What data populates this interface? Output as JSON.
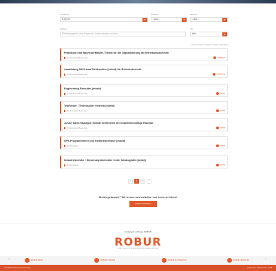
{
  "filters": {
    "position_label": "Positionen",
    "position_value": "8.00.00",
    "location_label": "Standort",
    "location_value": "- Alle -",
    "area_label": "Bereich",
    "area_value": "- Alle -",
    "search_label": "Suchen",
    "search_placeholder": "Stellenangebot oder Keyword, Unternehmen suchen",
    "type_label": "Art",
    "type_value": "Alle",
    "note": "Nur bei Cookies akzeptiert ist Stellen auffindbar!"
  },
  "jobs": [
    {
      "title": "Praktikum und Bachelor/Master-Thema für die Digitalisierung im Betriebsmaschinen",
      "meta": "Professional Bewerber",
      "badge": "Praktikum"
    },
    {
      "title": "Ausbildung 2022 zum Elektroniker (m/w/d) für Betriebstechnik",
      "meta": "Professional Bewerber",
      "badge": "Ausbildung"
    },
    {
      "title": "Engineering Recruiter (m/w/d)",
      "meta": "Professional Bewerber",
      "badge": "Vollzeit"
    },
    {
      "title": "Teamleiter / Technischer Vertrieb (m/w/d)",
      "meta": "Professional Bewerber",
      "badge": "Vollzeit"
    },
    {
      "title": "Junior Sales Manager (m/w/d) im Bereich der Industriemontage Robotor",
      "meta": "Professional Bewerber",
      "badge": "Vollzeit"
    },
    {
      "title": "SPS-Programmierer und Inbetriebnehmer (m/w/d)",
      "meta": "Professional",
      "badge": "Vollzeit"
    },
    {
      "title": "Industriemeister / Steuerungstechniker in der Intralogistik (m/w/d)",
      "meta": "Professional",
      "badge": "Vollzeit"
    }
  ],
  "pagination": {
    "prev": "‹",
    "pages": [
      "1",
      "2"
    ],
    "next": "›"
  },
  "cta": {
    "text": "Nichts gefunden? Wir freuen uns trotzdem von Ihnen zu hören!",
    "button": "Initiativ bewerben"
  },
  "footer": {
    "tagline": "Erfolgreich mit Team ROBUR",
    "logo": "ROBUR",
    "logo_sub": "DIE INDUSTRIEKOMPETENZGRUPPE",
    "sites": [
      "ROBUR WIND",
      "ROBUR TORQUE",
      "ROBUR AUTOMATION",
      "ROBUR INDUSTRY"
    ],
    "prev": "‹",
    "next": "›",
    "bottom_left": "© ROBUR Industry Service Group",
    "bottom_right": "Impressum · Datenschutz · AGB"
  },
  "colors": {
    "accent": "#e05a2b"
  }
}
